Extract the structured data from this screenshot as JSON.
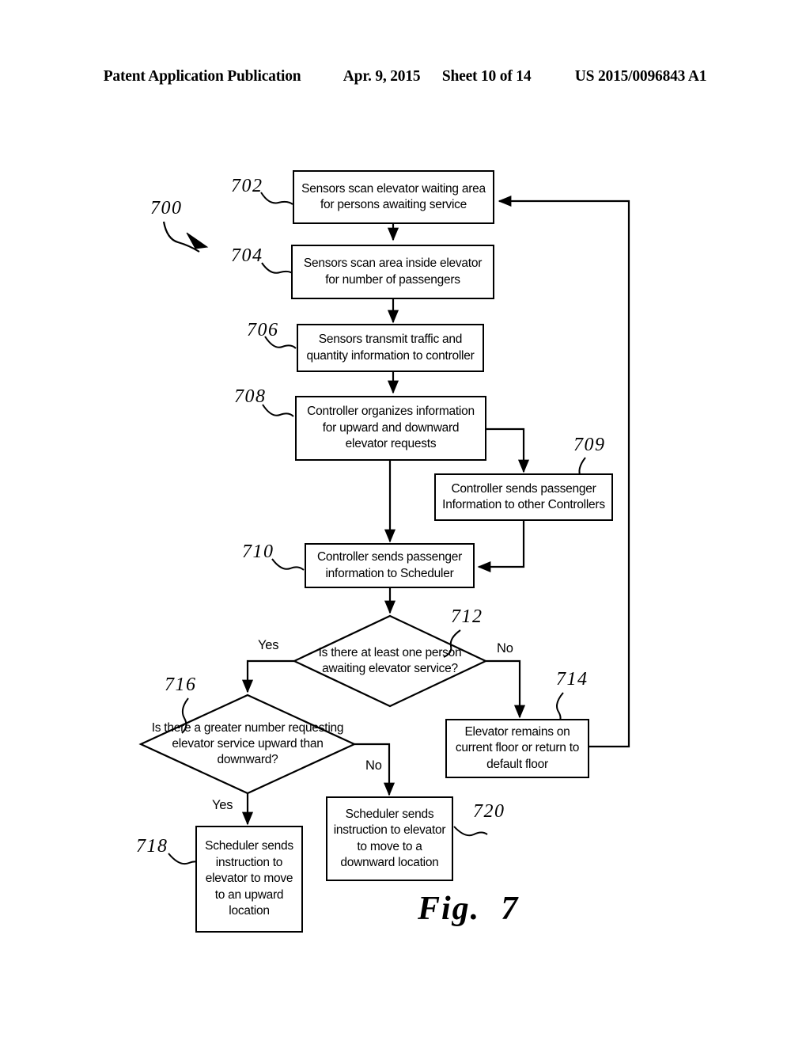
{
  "header": {
    "publication": "Patent Application Publication",
    "date": "Apr. 9, 2015",
    "sheet": "Sheet 10 of 14",
    "patent_number": "US 2015/0096843 A1"
  },
  "figure": {
    "caption_prefix": "Fig.",
    "caption_number": "7",
    "diagram_ref": "700"
  },
  "nodes": [
    {
      "ref": "702",
      "type": "process",
      "text": "Sensors scan elevator waiting area for persons awaiting service"
    },
    {
      "ref": "704",
      "type": "process",
      "text": "Sensors scan area inside elevator for number of passengers"
    },
    {
      "ref": "706",
      "type": "process",
      "text": "Sensors transmit traffic and quantity information to controller"
    },
    {
      "ref": "708",
      "type": "process",
      "text": "Controller organizes information for upward and downward elevator requests"
    },
    {
      "ref": "709",
      "type": "process",
      "text": "Controller sends passenger Information to other Controllers"
    },
    {
      "ref": "710",
      "type": "process",
      "text": "Controller sends passenger information to Scheduler"
    },
    {
      "ref": "712",
      "type": "decision",
      "text": "Is there at least one person awaiting elevator service?"
    },
    {
      "ref": "714",
      "type": "process",
      "text": "Elevator remains on current floor or return to default floor"
    },
    {
      "ref": "716",
      "type": "decision",
      "text": "Is there a greater number requesting elevator service upward than downward?"
    },
    {
      "ref": "718",
      "type": "process",
      "text": "Scheduler sends instruction to elevator to move to an upward location"
    },
    {
      "ref": "720",
      "type": "process",
      "text": "Scheduler sends instruction to elevator to move to a downward location"
    }
  ],
  "branch_labels": {
    "d712_yes": "Yes",
    "d712_no": "No",
    "d716_yes": "Yes",
    "d716_no": "No"
  },
  "colors": {
    "ink": "#000000",
    "paper": "#ffffff"
  }
}
